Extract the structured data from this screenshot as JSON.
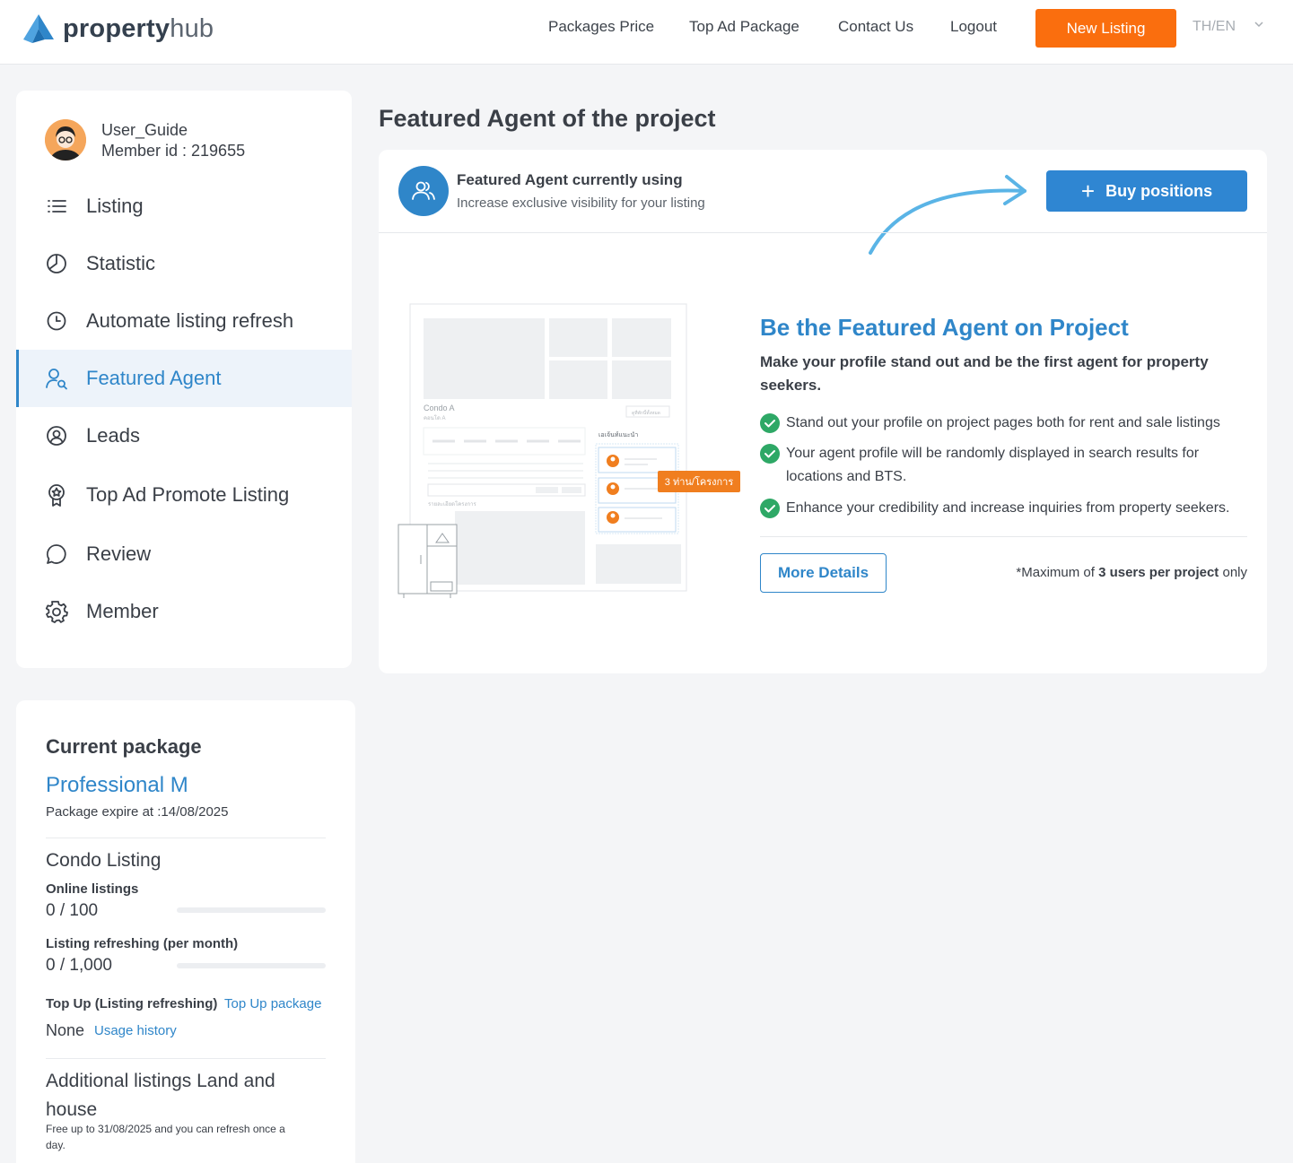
{
  "header": {
    "logo_bold": "property",
    "logo_light": "hub",
    "nav": [
      "Packages Price",
      "Top Ad Package",
      "Contact Us",
      "Logout"
    ],
    "new_listing": "New Listing",
    "lang": "TH/EN"
  },
  "user": {
    "name": "User_Guide",
    "member_id": "Member id : 219655"
  },
  "sidebar": {
    "items": [
      {
        "label": "Listing",
        "icon": "list-icon"
      },
      {
        "label": "Statistic",
        "icon": "pie-chart-icon"
      },
      {
        "label": "Automate listing refresh",
        "icon": "clock-icon"
      },
      {
        "label": "Featured Agent",
        "icon": "user-search-icon",
        "active": true
      },
      {
        "label": "Leads",
        "icon": "user-circle-icon"
      },
      {
        "label": "Top Ad Promote Listing",
        "icon": "badge-icon"
      },
      {
        "label": "Review",
        "icon": "chat-icon"
      },
      {
        "label": "Member",
        "icon": "gear-icon"
      }
    ]
  },
  "package": {
    "heading": "Current package",
    "name": "Professional M",
    "expire": "Package expire at :14/08/2025",
    "condo_heading": "Condo Listing",
    "online_label": "Online listings",
    "online_value": "0 / 100",
    "online_fraction": 0,
    "refresh_label": "Listing refreshing (per month)",
    "refresh_value": "0 / 1,000",
    "refresh_fraction": 0,
    "topup_label": "Top Up (Listing refreshing)",
    "topup_link": "Top Up package",
    "topup_value": "None",
    "usage_link": "Usage history",
    "additional_heading_1": "Additional listings Land and",
    "additional_heading_2": "house",
    "additional_note_1": "Free up to 31/08/2025 and you can refresh once a",
    "additional_note_2": "day."
  },
  "main": {
    "page_title": "Featured Agent of the project",
    "status_title": "Featured Agent currently using",
    "status_sub": "Increase exclusive visibility for your listing",
    "buy_button": "Buy positions",
    "promo_title": "Be the Featured Agent on Project",
    "promo_sub": "Make your profile stand out and be the first agent for property seekers.",
    "features": [
      "Stand out your profile on project pages both for rent and sale listings",
      "Your agent profile will be randomly displayed in search results for locations and BTS.",
      "Enhance your credibility and increase inquiries from property seekers."
    ],
    "more_details": "More Details",
    "max_prefix": "*Maximum of ",
    "max_bold": "3 users per project",
    "max_suffix": " only",
    "illus_condo": "Condo A",
    "illus_sub": "คอนโด A",
    "illus_agent_label": "เอเจ้นท์แนะนำ",
    "illus_tag": "3 ท่าน/โครงการ",
    "illus_detail": "รายละเอียดโครงการ",
    "illus_button": "ดูที่พักนี้ทั้งหมด"
  },
  "colors": {
    "accent": "#2f86c9",
    "orange": "#fa6e0e",
    "check": "#2ea866"
  }
}
